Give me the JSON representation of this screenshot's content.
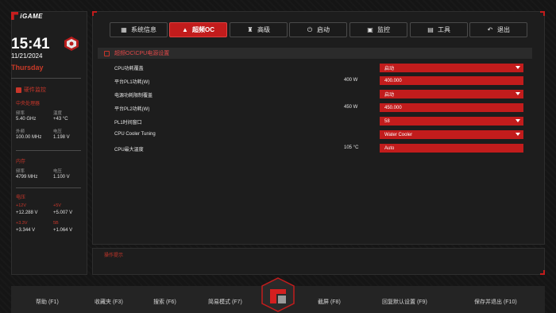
{
  "brand": "iGAME",
  "clock": {
    "time": "15:41",
    "date": "11/21/2024",
    "weekday": "Thursday"
  },
  "hw_monitor": {
    "title": "硬件监控",
    "cpu": {
      "title": "中央处理器",
      "freq_label": "频率",
      "freq_value": "5.40 GHz",
      "temp_label": "温度",
      "temp_value": "+43 °C",
      "bclk_label": "外频",
      "bclk_value": "100.00 MHz",
      "volt_label": "电压",
      "volt_value": "1.198 V"
    },
    "memory": {
      "title": "内存",
      "freq_label": "频率",
      "freq_value": "4799 MHz",
      "volt_label": "电压",
      "volt_value": "1.100 V"
    },
    "voltage": {
      "title": "电压",
      "v12_label": "+12V",
      "v12_value": "+12.288 V",
      "v5_label": "+5V",
      "v5_value": "+5.007 V",
      "v33_label": "+3.3V",
      "v33_value": "+3.344 V",
      "vsb_label": "5B",
      "vsb_value": "+1.064 V"
    }
  },
  "tabs": [
    {
      "label": "系统信息",
      "icon": "grid-icon",
      "active": false
    },
    {
      "label": "超频OC",
      "icon": "rocket-icon",
      "active": true
    },
    {
      "label": "高级",
      "icon": "advanced-icon",
      "active": false
    },
    {
      "label": "启动",
      "icon": "power-icon",
      "active": false
    },
    {
      "label": "监控",
      "icon": "monitor-icon",
      "active": false
    },
    {
      "label": "工具",
      "icon": "toolbox-icon",
      "active": false
    },
    {
      "label": "退出",
      "icon": "exit-arrow-icon",
      "active": false
    }
  ],
  "breadcrumb": "超频OC\\CPU电源设置",
  "settings": [
    {
      "label": "CPU功耗覆盖",
      "mid": "",
      "value": "启动",
      "dropdown": true
    },
    {
      "label": "平台PL1功耗(W)",
      "mid": "400 W",
      "value": "400.000",
      "dropdown": false
    },
    {
      "label": "电源功耗限制覆盖",
      "mid": "",
      "value": "启动",
      "dropdown": true
    },
    {
      "label": "平台PL2功耗(W)",
      "mid": "450 W",
      "value": "450.000",
      "dropdown": false
    },
    {
      "label": "PL1时间窗口",
      "mid": "",
      "value": "58",
      "dropdown": true
    },
    {
      "label": "CPU Cooler Tuning",
      "mid": "",
      "value": "Water Cooler",
      "dropdown": true
    },
    {
      "label": "CPU最大温度",
      "mid": "105 °C",
      "value": "Auto",
      "dropdown": false
    }
  ],
  "help_title": "操作提示",
  "function_keys": [
    "帮助 (F1)",
    "收藏夹 (F3)",
    "搜索 (F6)",
    "简易模式 (F7)",
    "截屏 (F8)",
    "回复默认设置 (F9)",
    "保存并退出 (F10)"
  ],
  "colors": {
    "accent": "#c21c1c",
    "accent_text": "#c8362a",
    "panel": "#1d1d1d"
  }
}
